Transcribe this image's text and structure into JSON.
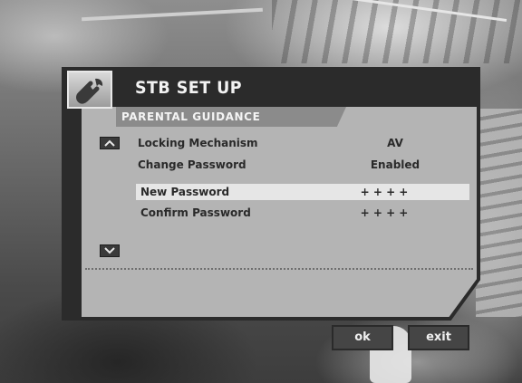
{
  "menu": {
    "title": "STB SET UP",
    "section": "PARENTAL GUIDANCE",
    "icon": "wrench-icon",
    "rows": [
      {
        "label": "Locking Mechanism",
        "value": "AV"
      },
      {
        "label": "Change Password",
        "value": "Enabled"
      },
      {
        "label": "New Password",
        "value": "+ + + +"
      },
      {
        "label": "Confirm Password",
        "value": "+ + + +"
      }
    ]
  },
  "buttons": {
    "ok": "ok",
    "exit": "exit"
  },
  "colors": {
    "frame": "#2b2b2b",
    "body": "#b4b4b4",
    "header": "#8b8b8b",
    "highlight": "#e6e6e6"
  }
}
